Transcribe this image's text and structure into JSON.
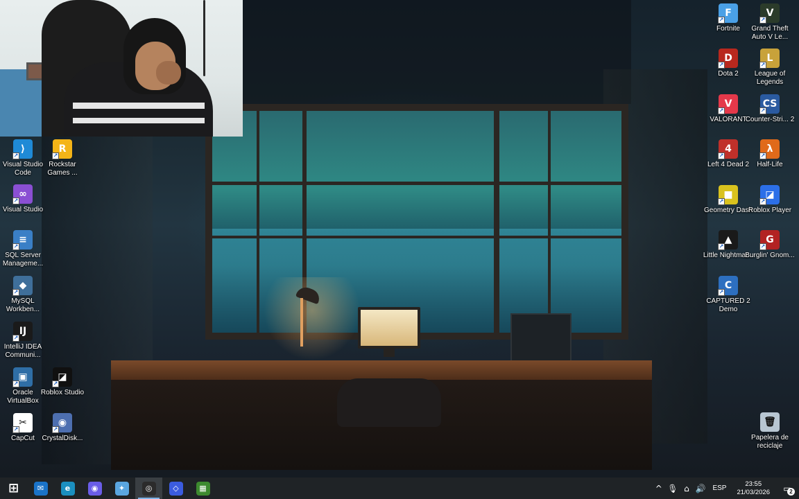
{
  "desktop": {
    "left_icons": [
      {
        "label": "Visual Studio Code",
        "icon": "vscode-icon",
        "glyph": "⟩",
        "color": "#1f8ad6"
      },
      {
        "label": "Rockstar Games ...",
        "icon": "rockstar-icon",
        "glyph": "R",
        "color": "#f4b417"
      },
      {
        "label": "Visual Studio",
        "icon": "visual-studio-icon",
        "glyph": "∞",
        "color": "#8a4fd3"
      },
      {
        "label": "SQL Server Manageme...",
        "icon": "sql-server-icon",
        "glyph": "≡",
        "color": "#3a7fc6"
      },
      {
        "label": "MySQL Workben...",
        "icon": "mysql-workbench-icon",
        "glyph": "◆",
        "color": "#3f6f9a"
      },
      {
        "label": "IntelliJ IDEA Communi...",
        "icon": "intellij-icon",
        "glyph": "IJ",
        "color": "#1a1a1a"
      },
      {
        "label": "Oracle VirtualBox",
        "icon": "virtualbox-icon",
        "glyph": "▣",
        "color": "#2f6ea6"
      },
      {
        "label": "Roblox Studio",
        "icon": "roblox-studio-icon",
        "glyph": "◪",
        "color": "#101010"
      },
      {
        "label": "CapCut",
        "icon": "capcut-icon",
        "glyph": "✂",
        "color": "#ffffff"
      },
      {
        "label": "CrystalDisk...",
        "icon": "crystaldisk-icon",
        "glyph": "◉",
        "color": "#4d6fb0"
      }
    ],
    "right_icons": [
      {
        "label": "Fortnite",
        "icon": "fortnite-icon",
        "glyph": "F",
        "color": "#4aa0e6"
      },
      {
        "label": "Grand Theft Auto V Le...",
        "icon": "gta-v-icon",
        "glyph": "V",
        "color": "#2b3b2a"
      },
      {
        "label": "Dota 2",
        "icon": "dota2-icon",
        "glyph": "D",
        "color": "#b8281e"
      },
      {
        "label": "League of Legends",
        "icon": "league-of-legends-icon",
        "glyph": "L",
        "color": "#c8a23a"
      },
      {
        "label": "VALORANT",
        "icon": "valorant-icon",
        "glyph": "V",
        "color": "#e4384a"
      },
      {
        "label": "Counter-Stri... 2",
        "icon": "counter-strike-icon",
        "glyph": "CS",
        "color": "#2a5aa0"
      },
      {
        "label": "Left 4 Dead 2",
        "icon": "left4dead2-icon",
        "glyph": "4",
        "color": "#c0302a"
      },
      {
        "label": "Half-Life",
        "icon": "half-life-icon",
        "glyph": "λ",
        "color": "#e06a1a"
      },
      {
        "label": "Geometry Dash",
        "icon": "geometry-dash-icon",
        "glyph": "■",
        "color": "#d9c21e"
      },
      {
        "label": "Roblox Player",
        "icon": "roblox-player-icon",
        "glyph": "◪",
        "color": "#2c6fe8"
      },
      {
        "label": "Little Nightmar...",
        "icon": "little-nightmares-icon",
        "glyph": "▲",
        "color": "#1a1a1a"
      },
      {
        "label": "Burglin' Gnom...",
        "icon": "burglin-gnomes-icon",
        "glyph": "G",
        "color": "#b22222"
      },
      {
        "label": "CAPTURED 2 Demo",
        "icon": "captured2-demo-icon",
        "glyph": "C",
        "color": "#2d6fc0"
      },
      {
        "label": "Papelera de reciclaje",
        "icon": "recycle-bin-icon",
        "glyph": "🗑",
        "color": "#b8c6d2"
      }
    ]
  },
  "taskbar": {
    "apps": [
      {
        "name": "start-button",
        "glyph": "⊞",
        "color": "transparent"
      },
      {
        "name": "outlook-icon",
        "glyph": "✉",
        "color": "#1a73c8"
      },
      {
        "name": "edge-icon",
        "glyph": "e",
        "color": "#1b8fbf"
      },
      {
        "name": "discord-icon",
        "glyph": "◉",
        "color": "#6a5de8"
      },
      {
        "name": "copilot-icon",
        "glyph": "✦",
        "color": "#5aa6e0"
      },
      {
        "name": "obs-icon",
        "glyph": "◎",
        "color": "#2b2b2b"
      },
      {
        "name": "antigravity-icon",
        "glyph": "◇",
        "color": "#3b5ce0"
      },
      {
        "name": "minecraft-icon",
        "glyph": "▦",
        "color": "#3d8a2f"
      }
    ],
    "tray": {
      "show_hidden_label": "^",
      "language": "ESP",
      "time": "23:55",
      "date": "21/03/2026",
      "notifications_count": "2"
    }
  }
}
